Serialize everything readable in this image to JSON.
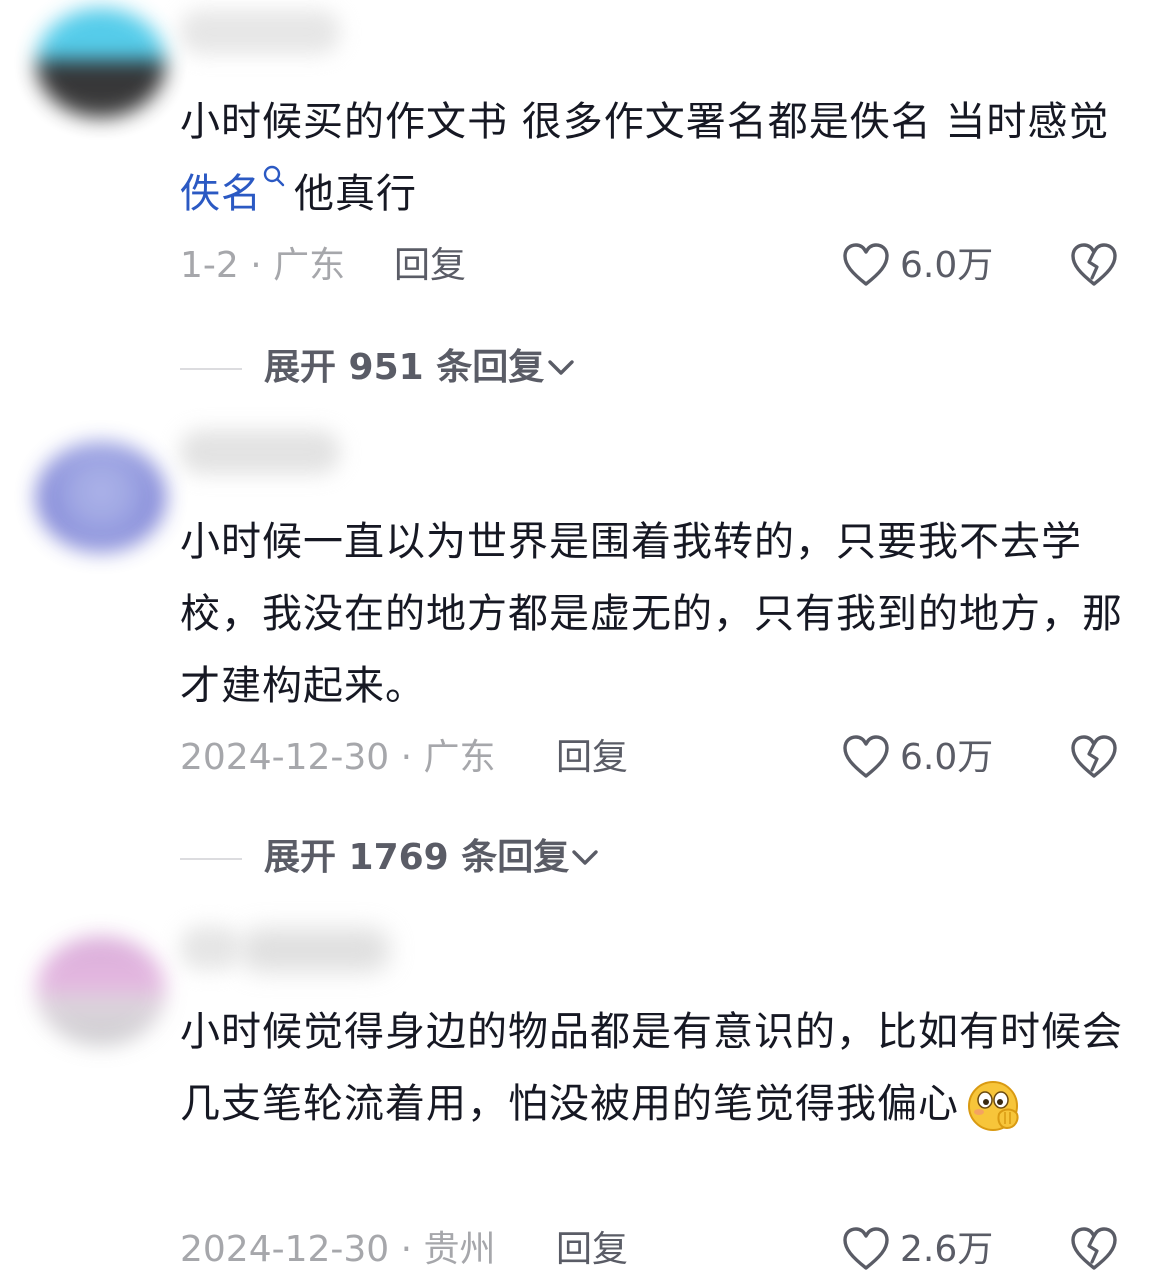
{
  "comments": [
    {
      "text_before": "小时候买的作文书  很多作文署名都是佚名 当时感觉",
      "keyword": "佚名",
      "text_after": "他真行",
      "date_location": "1-2 · 广东",
      "reply_label": "回复",
      "likes": "6.0万"
    },
    {
      "text": "小时候一直以为世界是围着我转的，只要我不去学校，我没在的地方都是虚无的，只有我到的地方，那才建构起来。",
      "date_location": "2024-12-30 · 广东",
      "reply_label": "回复",
      "likes": "6.0万"
    },
    {
      "text": "小时候觉得身边的物品都是有意识的，比如有时候会几支笔轮流着用，怕没被用的笔觉得我偏心",
      "emoji": "smiling-face-with-hand-over-mouth",
      "date_location": "2024-12-30 · 贵州",
      "reply_label": "回复",
      "likes": "2.6万"
    }
  ],
  "expand_replies": [
    {
      "label": "展开 951 条回复"
    },
    {
      "label": "展开 1769 条回复"
    }
  ],
  "colors": {
    "text": "#161823",
    "secondary_text": "#a6a7ab",
    "action_text": "#5a5c66",
    "link": "#2b59c3",
    "divider": "#dcdcdf"
  },
  "icons": {
    "like": "heart-icon",
    "dislike": "broken-heart-icon",
    "expand": "chevron-down-icon",
    "search": "search-icon"
  }
}
